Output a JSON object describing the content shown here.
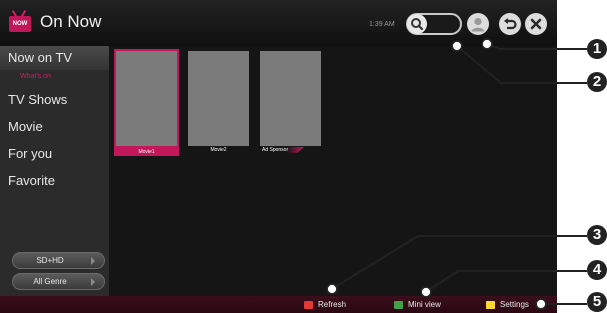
{
  "header": {
    "title": "On Now",
    "logo_text": "NOW",
    "clock": "1:39 AM",
    "icons": {
      "logo": "tv-logo-icon",
      "search": "search-icon",
      "user": "user-icon",
      "back": "back-icon",
      "close": "close-icon"
    }
  },
  "sidebar": {
    "items": [
      {
        "label": "Now on TV",
        "active": true
      },
      {
        "label": "What's on",
        "sub": true
      },
      {
        "label": "TV Shows"
      },
      {
        "label": "Movie"
      },
      {
        "label": "For you"
      },
      {
        "label": "Favorite"
      }
    ],
    "filters": {
      "quality": "SD+HD",
      "genre": "All Genre"
    }
  },
  "content": {
    "cards": [
      {
        "caption": "Movie1",
        "selected": true
      },
      {
        "caption": "Movie2"
      },
      {
        "caption": "Ad Sponsor"
      }
    ]
  },
  "footer": {
    "refresh": "Refresh",
    "miniview": "Mini view",
    "settings": "Settings",
    "key_colors": {
      "refresh": "#e53935",
      "miniview": "#43a047",
      "settings": "#fdd835"
    }
  },
  "callouts": [
    "1",
    "2",
    "3",
    "4",
    "5"
  ],
  "colors": {
    "accent": "#c2185b",
    "background": "#151515",
    "sidebar": "#2b2b2b"
  }
}
